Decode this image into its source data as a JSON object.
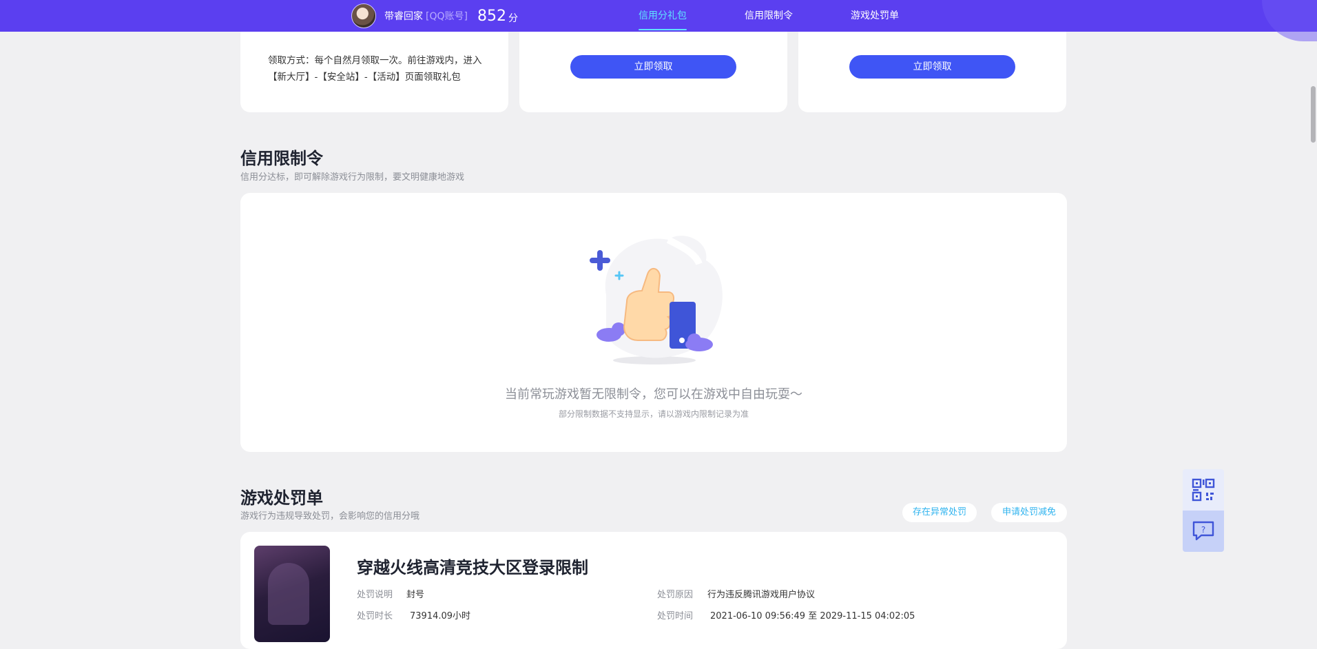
{
  "header": {
    "user_name": "带睿回家",
    "account_type": "[QQ账号]",
    "score": "852",
    "score_unit": "分",
    "tabs": [
      {
        "label": "信用分礼包",
        "active": true
      },
      {
        "label": "信用限制令",
        "active": false
      },
      {
        "label": "游戏处罚单",
        "active": false
      }
    ]
  },
  "gift_section": {
    "card1_desc": "领取方式：每个自然月领取一次。前往游戏内，进入【新大厅】-【安全站】-【活动】页面领取礼包",
    "claim_button_label": "立即领取"
  },
  "restriction_section": {
    "title": "信用限制令",
    "subtitle": "信用分达标，即可解除游戏行为限制，要文明健康地游戏",
    "empty_main": "当前常玩游戏暂无限制令，您可以在游戏中自由玩耍～",
    "empty_sub": "部分限制数据不支持显示，请以游戏内限制记录为准"
  },
  "penalty_section": {
    "title": "游戏处罚单",
    "subtitle": "游戏行为违规导致处罚，会影响您的信用分哦",
    "report_abnormal_label": "存在异常处罚",
    "apply_reduction_label": "申请处罚减免",
    "item": {
      "game_title": "穿越火线高清竞技大区登录限制",
      "desc_label": "处罚说明",
      "desc_value": "封号",
      "reason_label": "处罚原因",
      "reason_value": "行为违反腾讯游戏用户协议",
      "duration_label": "处罚时长",
      "duration_value": "73914.09小时",
      "time_label": "处罚时间",
      "time_value": "2021-06-10 09:56:49 至 2029-11-15 04:02:05"
    }
  },
  "side_tools": {
    "qr_icon": "qr-code-icon",
    "help_icon": "help-chat-icon"
  },
  "colors": {
    "header_bg": "#5b3ff0",
    "active_tab": "#5fe3ff",
    "primary_button": "#3f55f5",
    "pill_text": "#2fb3ef"
  }
}
